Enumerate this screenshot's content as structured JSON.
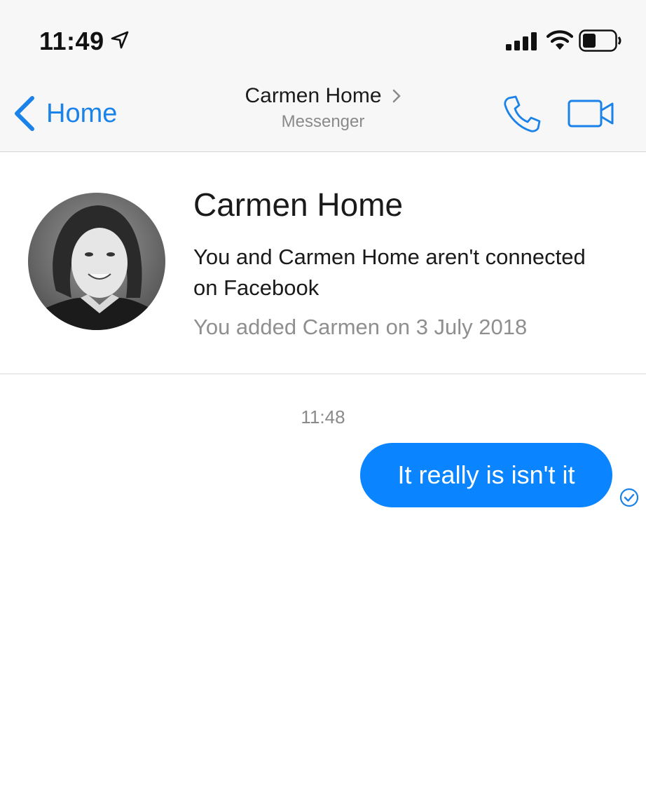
{
  "status_bar": {
    "time": "11:49",
    "icons": [
      "location-arrow-icon",
      "cellular-signal-icon",
      "wifi-icon",
      "battery-icon"
    ]
  },
  "nav": {
    "back_label": "Home",
    "title": "Carmen Home",
    "subtitle": "Messenger",
    "icons": [
      "back-chevron-icon",
      "chevron-right-icon",
      "phone-icon",
      "video-camera-icon"
    ],
    "accent_color": "#1a82e8"
  },
  "contact_card": {
    "name": "Carmen Home",
    "connection_text": "You and Carmen Home aren't connected on Facebook",
    "added_text": "You added Carmen on 3 July 2018"
  },
  "conversation": {
    "timestamp": "11:48",
    "messages": [
      {
        "sender": "me",
        "text": "It really is isn't it",
        "status": "sent",
        "bubble_color": "#0a84ff"
      }
    ]
  }
}
